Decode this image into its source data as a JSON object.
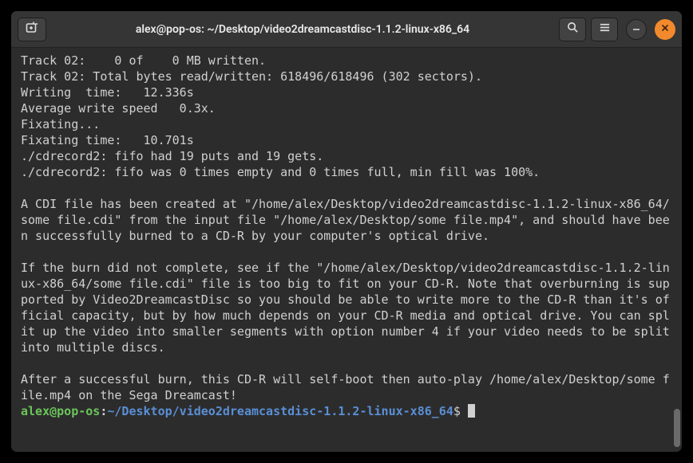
{
  "window": {
    "title": "alex@pop-os: ~/Desktop/video2dreamcastdisc-1.1.2-linux-x86_64"
  },
  "terminal": {
    "lines": [
      "Track 02:    0 of    0 MB written.",
      "Track 02: Total bytes read/written: 618496/618496 (302 sectors).",
      "Writing  time:   12.336s",
      "Average write speed   0.3x.",
      "Fixating...",
      "Fixating time:   10.701s",
      "./cdrecord2: fifo had 19 puts and 19 gets.",
      "./cdrecord2: fifo was 0 times empty and 0 times full, min fill was 100%.",
      "",
      "A CDI file has been created at \"/home/alex/Desktop/video2dreamcastdisc-1.1.2-linux-x86_64/some file.cdi\" from the input file \"/home/alex/Desktop/some file.mp4\", and should have been successfully burned to a CD-R by your computer's optical drive.",
      "",
      "If the burn did not complete, see if the \"/home/alex/Desktop/video2dreamcastdisc-1.1.2-linux-x86_64/some file.cdi\" file is too big to fit on your CD-R. Note that overburning is supported by Video2DreamcastDisc so you should be able to write more to the CD-R than it's official capacity, but by how much depends on your CD-R media and optical drive. You can split up the video into smaller segments with option number 4 if your video needs to be split into multiple discs.",
      "",
      "After a successful burn, this CD-R will self-boot then auto-play /home/alex/Desktop/some file.mp4 on the Sega Dreamcast!"
    ],
    "prompt": {
      "user": "alex@pop-os",
      "colon": ":",
      "path": "~/Desktop/video2dreamcastdisc-1.1.2-linux-x86_64",
      "dollar": "$"
    }
  }
}
